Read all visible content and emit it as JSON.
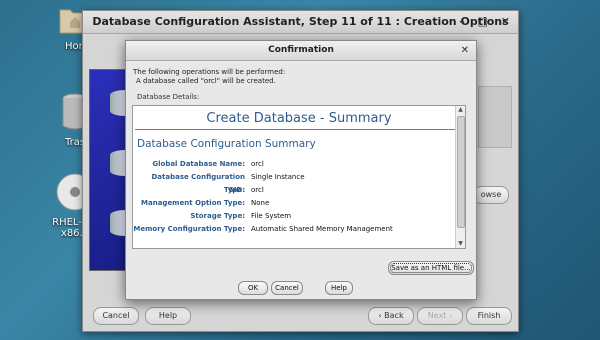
{
  "desktop": {
    "icons": [
      {
        "name": "home-folder",
        "label": "Hon"
      },
      {
        "name": "trash",
        "label": "Tras"
      },
      {
        "name": "rhel-disc",
        "label": "RHEL-7.9\nx86..."
      }
    ]
  },
  "main_window": {
    "title": "Database Configuration Assistant, Step 11 of 11 : Creation Options",
    "buttons": {
      "cancel": "Cancel",
      "help": "Help",
      "back": "Back",
      "next": "Next",
      "finish": "Finish",
      "browse_partial": "owse"
    }
  },
  "dialog": {
    "title": "Confirmation",
    "info_lines": [
      "The following operations will be performed:",
      "A database called \"orcl\" will be created."
    ],
    "details_label": "Database Details:",
    "summary": {
      "heading": "Create Database - Summary",
      "subheading": "Database Configuration Summary",
      "rows": [
        {
          "key": "Global Database Name:",
          "value": "orcl"
        },
        {
          "key": "Database Configuration Type:",
          "value": "Single Instance"
        },
        {
          "key": "SID:",
          "value": "orcl"
        },
        {
          "key": "Management Option Type:",
          "value": "None"
        },
        {
          "key": "Storage Type:",
          "value": "File System"
        },
        {
          "key": "Memory Configuration Type:",
          "value": "Automatic Shared Memory Management"
        }
      ]
    },
    "buttons": {
      "save_html": "Save as an HTML file...",
      "ok": "OK",
      "cancel": "Cancel",
      "help": "Help"
    }
  }
}
